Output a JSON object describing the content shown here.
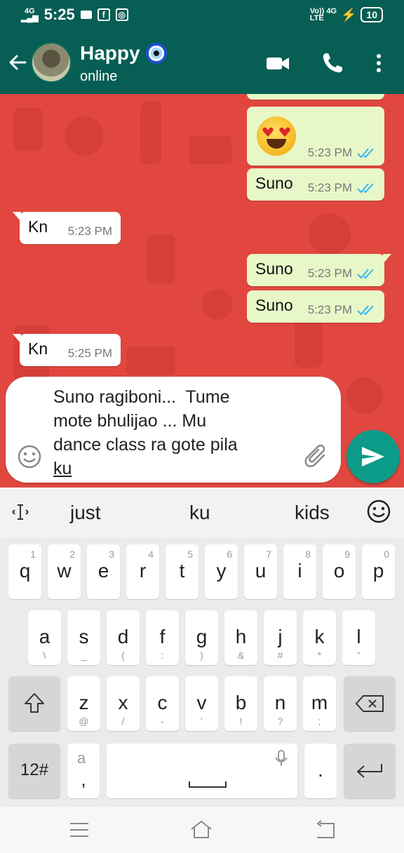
{
  "status_bar": {
    "network": "4G",
    "time": "5:25",
    "volte": "Vo)) 4G\nLTE",
    "battery": "10"
  },
  "header": {
    "contact_name": "Happy",
    "contact_status": "online"
  },
  "messages": [
    {
      "direction": "out",
      "text": "",
      "emoji": "heart-eyes-emoji",
      "time": "5:23 PM"
    },
    {
      "direction": "out",
      "text": "Suno",
      "time": "5:23 PM"
    },
    {
      "direction": "in",
      "text": "Kn",
      "time": "5:23 PM"
    },
    {
      "direction": "out",
      "text": "Suno",
      "time": "5:23 PM"
    },
    {
      "direction": "out",
      "text": "Suno",
      "time": "5:23 PM"
    },
    {
      "direction": "in",
      "text": "Kn",
      "time": "5:25 PM"
    }
  ],
  "composer": {
    "text_before": "Suno ragiboni...  Tume\nmote bhulijao ... Mu\ndance class ra gote pila\n",
    "text_typed": "ku"
  },
  "keyboard": {
    "suggestions": [
      "just",
      "ku",
      "kids"
    ],
    "row1": [
      {
        "key": "q",
        "hint": "1"
      },
      {
        "key": "w",
        "hint": "2"
      },
      {
        "key": "e",
        "hint": "3"
      },
      {
        "key": "r",
        "hint": "4"
      },
      {
        "key": "t",
        "hint": "5"
      },
      {
        "key": "y",
        "hint": "6"
      },
      {
        "key": "u",
        "hint": "7"
      },
      {
        "key": "i",
        "hint": "8"
      },
      {
        "key": "o",
        "hint": "9"
      },
      {
        "key": "p",
        "hint": "0"
      }
    ],
    "row2": [
      {
        "key": "a",
        "sub": "\\"
      },
      {
        "key": "s",
        "sub": "_"
      },
      {
        "key": "d",
        "sub": "("
      },
      {
        "key": "f",
        "sub": ":"
      },
      {
        "key": "g",
        "sub": ")"
      },
      {
        "key": "h",
        "sub": "&"
      },
      {
        "key": "j",
        "sub": "#"
      },
      {
        "key": "k",
        "sub": "*"
      },
      {
        "key": "l",
        "sub": "\""
      }
    ],
    "row3": [
      {
        "key": "z",
        "sub": "@"
      },
      {
        "key": "x",
        "sub": "/"
      },
      {
        "key": "c",
        "sub": "-"
      },
      {
        "key": "v",
        "sub": "'"
      },
      {
        "key": "b",
        "sub": "!"
      },
      {
        "key": "n",
        "sub": "?"
      },
      {
        "key": "m",
        "sub": ";"
      }
    ],
    "symbols_key": "12#",
    "comma_key": ",",
    "lang_glyph": "a",
    "period_key": "."
  }
}
